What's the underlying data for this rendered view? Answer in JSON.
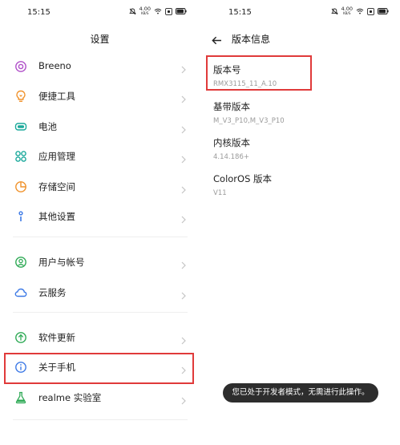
{
  "status_bar": {
    "time": "15:15",
    "speed_value": "4.00",
    "speed_unit": "KB/S",
    "battery_level": 0.9
  },
  "left_panel": {
    "title": "设置",
    "items": [
      {
        "label": "Breeno",
        "icon": "breeno-icon"
      },
      {
        "label": "便捷工具",
        "icon": "tools-icon"
      },
      {
        "label": "电池",
        "icon": "battery-icon"
      },
      {
        "label": "应用管理",
        "icon": "apps-icon"
      },
      {
        "label": "存储空间",
        "icon": "storage-icon"
      },
      {
        "label": "其他设置",
        "icon": "more-settings-icon"
      },
      {
        "label": "用户与帐号",
        "icon": "user-icon"
      },
      {
        "label": "云服务",
        "icon": "cloud-icon"
      },
      {
        "label": "软件更新",
        "icon": "update-icon"
      },
      {
        "label": "关于手机",
        "icon": "info-icon",
        "highlighted": true
      },
      {
        "label": "realme 实验室",
        "icon": "lab-icon"
      }
    ]
  },
  "right_panel": {
    "title": "版本信息",
    "items": [
      {
        "title": "版本号",
        "value": "RMX3115_11_A.10",
        "highlighted": true
      },
      {
        "title": "基带版本",
        "value": "M_V3_P10,M_V3_P10"
      },
      {
        "title": "内核版本",
        "value": "4.14.186+"
      },
      {
        "title": "ColorOS 版本",
        "value": "V11"
      }
    ]
  },
  "toast": {
    "text": "您已处于开发者模式，无需进行此操作。"
  },
  "colors": {
    "highlight_box": "#e03a3a",
    "icon_purple": "#b04fc9",
    "icon_orange": "#f0922b",
    "icon_teal": "#1aa99b",
    "icon_blue": "#3c79e6",
    "icon_green": "#2faa56",
    "toast_bg": "#2d2d2d"
  }
}
